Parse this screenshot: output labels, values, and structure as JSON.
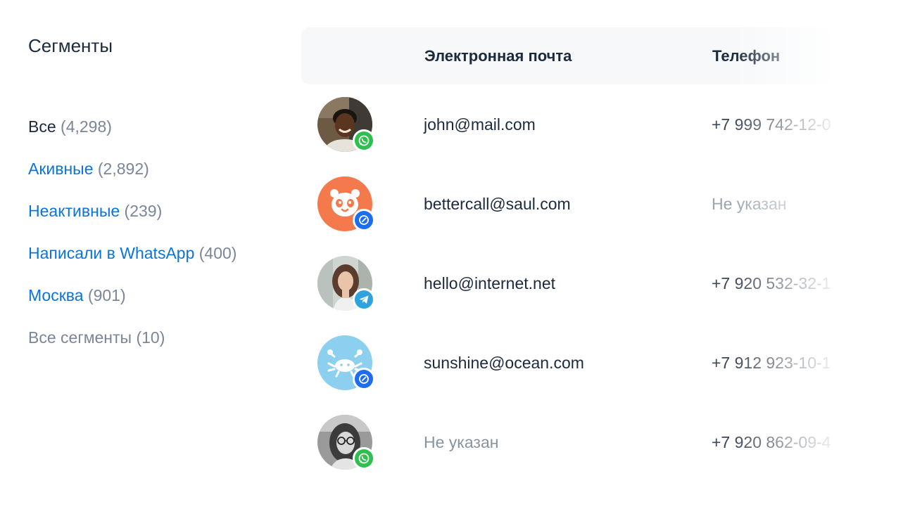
{
  "sidebar": {
    "title": "Сегменты",
    "items": [
      {
        "label": "Все",
        "count": "(4,298)"
      },
      {
        "label": "Акивные",
        "count": "(2,892)"
      },
      {
        "label": "Неактивные",
        "count": "(239)"
      },
      {
        "label": "Написали в WhatsApp",
        "count": "(400)"
      },
      {
        "label": "Москва",
        "count": "(901)"
      },
      {
        "label": "Все сегменты",
        "count": "(10)"
      }
    ]
  },
  "table": {
    "columns": {
      "email": "Электронная почта",
      "phone": "Телефон"
    },
    "rows": [
      {
        "avatar": "photo-man",
        "channel": "whatsapp-icon",
        "email": "john@mail.com",
        "phone": "+7 999 742-12-0"
      },
      {
        "avatar": "panda-icon",
        "channel": "chat-icon",
        "email": "bettercall@saul.com",
        "phone": "Не указан"
      },
      {
        "avatar": "photo-woman",
        "channel": "telegram-icon",
        "email": "hello@internet.net",
        "phone": "+7 920 532-32-1"
      },
      {
        "avatar": "crab-icon",
        "channel": "chat-icon",
        "email": "sunshine@ocean.com",
        "phone": "+7 912 923-10-1"
      },
      {
        "avatar": "photo-woman-glasses",
        "channel": "whatsapp-icon",
        "email": "Не указан",
        "phone": "+7 920 862-09-4"
      }
    ]
  },
  "colors": {
    "link": "#0a74da",
    "text": "#1c2a3d",
    "muted": "#7b8697",
    "header_bg": "#f6f8fa",
    "whatsapp": "#2fbf4f",
    "chat": "#1d6df0",
    "telegram": "#2ea3dd",
    "panda_bg": "#f4794d",
    "crab_bg": "#8ccfee"
  }
}
